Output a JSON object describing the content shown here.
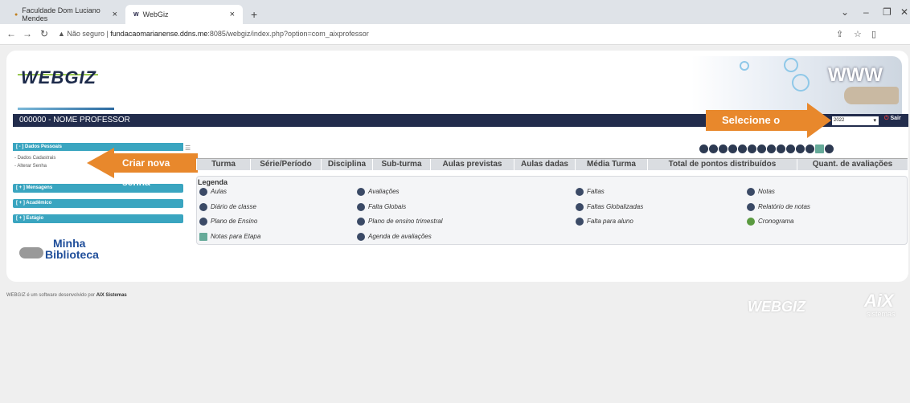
{
  "browser": {
    "tab1": "Faculdade Dom Luciano Mendes",
    "tab2": "WebGiz",
    "tab_close": "×",
    "new_tab": "+",
    "not_secure": "Não seguro",
    "url_host": "fundacaomarianense.ddns.me",
    "url_path": ":8085/webgiz/index.php?option=com_aixprofessor"
  },
  "header": {
    "logo": "WEBGIZ",
    "deco_text": "WWW",
    "user": "000000 - NOME PROFESSOR",
    "period_label": "2022",
    "sair": "Sair"
  },
  "callouts": {
    "period": "Selecione o período",
    "senha": "Criar nova senha"
  },
  "sidebar": {
    "dados_pessoais": "[ - ] Dados Pessoais",
    "dados_cadastrais": "- Dados Cadastrais",
    "alterar_senha": "- Alterar Senha",
    "mensagens": "[ + ] Mensagens",
    "academico": "[ + ] Acadêmico",
    "estagio": "[ + ] Estágio"
  },
  "minha_biblioteca": {
    "line1": "Minha",
    "line2": "Biblioteca"
  },
  "grid_columns": [
    "Turma",
    "Série/Período",
    "Disciplina",
    "Sub-turma",
    "Aulas previstas",
    "Aulas dadas",
    "Média Turma",
    "Total de pontos distribuídos",
    "Quant. de avaliações"
  ],
  "legend": {
    "title": "Legenda",
    "items": [
      "Aulas",
      "Avaliações",
      "Faltas",
      "Notas",
      "Diário de classe",
      "Falta Globais",
      "Faltas Globalizadas",
      "Relatório de notas",
      "Plano de Ensino",
      "Plano de ensino trimestral",
      "Falta para aluno",
      "Cronograma",
      "Notas para Etapa",
      "Agenda de avaliações"
    ]
  },
  "footer": {
    "text_prefix": "WEBGIZ é um software desenvolvido por",
    "company": "AIX Sistemas",
    "logo": "WEBGIZ",
    "aix": "AiX",
    "sistemas": "sistemas"
  },
  "colors": {
    "accent_orange": "#e8882c",
    "sidebar_blue": "#3aa5c0",
    "userbar_navy": "#222c4c"
  }
}
